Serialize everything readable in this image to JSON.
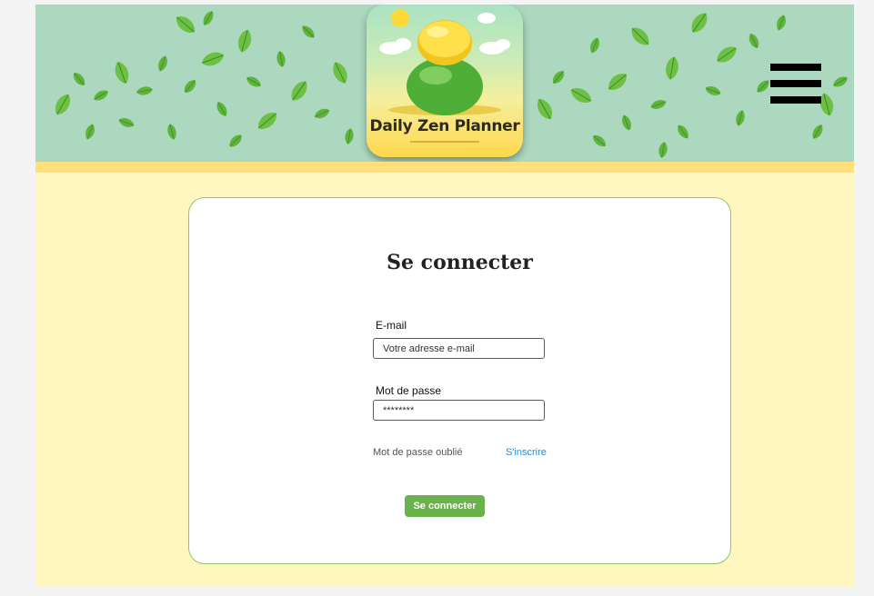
{
  "header": {
    "logo_text": "Daily Zen Planner",
    "menu_icon": "hamburger-menu-icon"
  },
  "login": {
    "title": "Se connecter",
    "email_label": "E-mail",
    "email_placeholder": "Votre adresse e-mail",
    "password_label": "Mot de passe",
    "password_value": "********",
    "forgot_password_link": "Mot de passe oublié",
    "signup_link": "S'inscrire",
    "submit_label": "Se connecter"
  },
  "colors": {
    "header_bg": "#acd8bf",
    "page_bg": "#fff6c0",
    "accent_green": "#6ab24a",
    "link_blue": "#1d8fd8",
    "stripe_yellow": "#ffe07a"
  }
}
